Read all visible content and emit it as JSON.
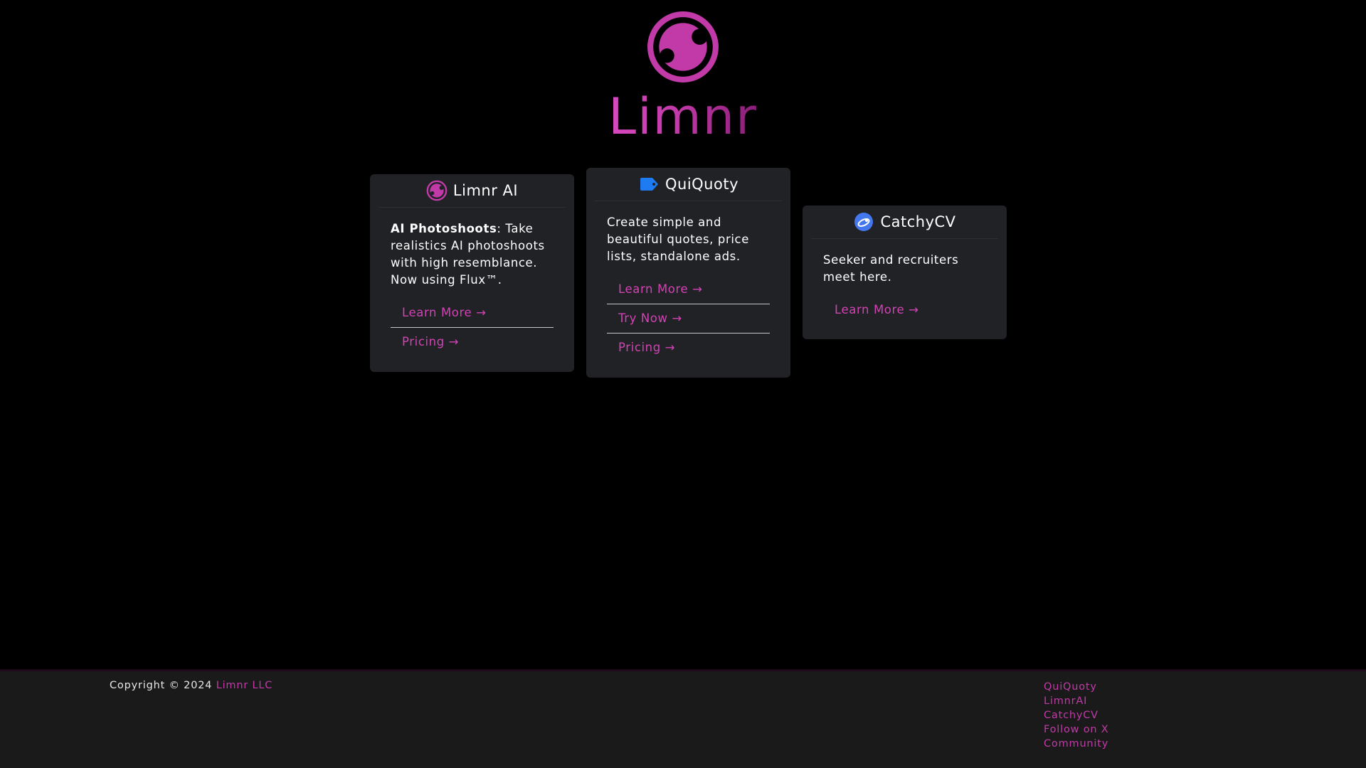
{
  "hero": {
    "title": "Limnr",
    "logo_icon": "limnr-eye-icon"
  },
  "colors": {
    "accent": "#c23aa8",
    "link": "#d243b4",
    "card_bg": "#202226",
    "quiquoty_icon": "#1e7bf2",
    "catchy_icon": "#4477ee"
  },
  "cards": [
    {
      "title": "Limnr AI",
      "icon": "limnr-eye-icon",
      "description_bold": "AI Photoshoots",
      "description": ": Take realistics AI photoshoots with high resemblance. Now using Flux™.",
      "links": [
        "Learn More →",
        "Pricing →"
      ]
    },
    {
      "title": "QuiQuoty",
      "icon": "price-tag-icon",
      "description": "Create simple and beautiful quotes, price lists, standalone ads.",
      "links": [
        "Learn More →",
        "Try Now →",
        "Pricing →"
      ]
    },
    {
      "title": "CatchyCV",
      "icon": "cv-globe-icon",
      "description": "Seeker and recruiters meet here.",
      "links": [
        "Learn More →"
      ]
    }
  ],
  "footer": {
    "copyright_prefix": "Copyright © 2024 ",
    "company": "Limnr LLC",
    "links": [
      "QuiQuoty",
      "LimnrAI",
      "CatchyCV",
      "Follow on X",
      "Community"
    ]
  }
}
